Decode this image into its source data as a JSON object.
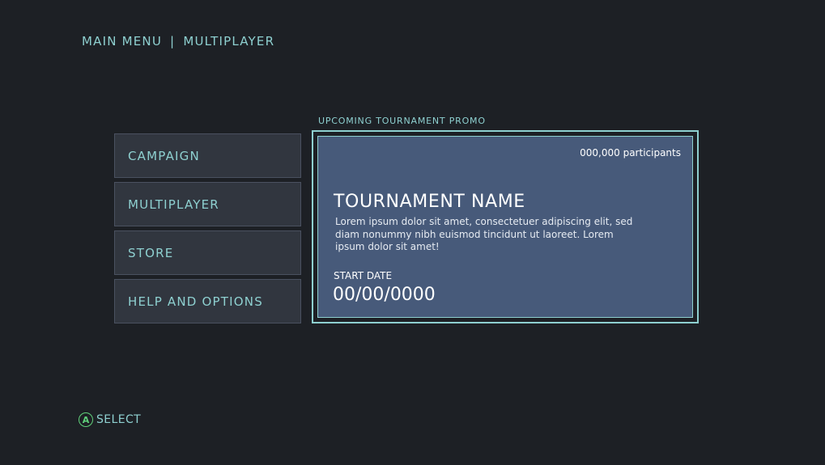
{
  "breadcrumb": {
    "parent": "MAIN MENU",
    "separator": "|",
    "current": "MULTIPLAYER"
  },
  "menu": {
    "items": [
      {
        "label": "CAMPAIGN"
      },
      {
        "label": "MULTIPLAYER"
      },
      {
        "label": "STORE"
      },
      {
        "label": "HELP AND OPTIONS"
      }
    ]
  },
  "promo": {
    "section_label": "UPCOMING TOURNAMENT PROMO",
    "participants": "000,000 participants",
    "name": "TOURNAMENT NAME",
    "description": "Lorem ipsum dolor sit amet, consectetuer adipiscing elit, sed diam nonummy nibh euismod tincidunt ut laoreet. Lorem ipsum dolor sit amet!",
    "start_label": "START DATE",
    "start_date": "00/00/0000"
  },
  "footer": {
    "button_glyph": "A",
    "select_label": "SELECT"
  },
  "colors": {
    "background": "#1d2025",
    "accent": "#8ed0d0",
    "menu_item_bg": "#31363f",
    "promo_bg": "#475a7a",
    "a_button": "#5fd07a"
  }
}
